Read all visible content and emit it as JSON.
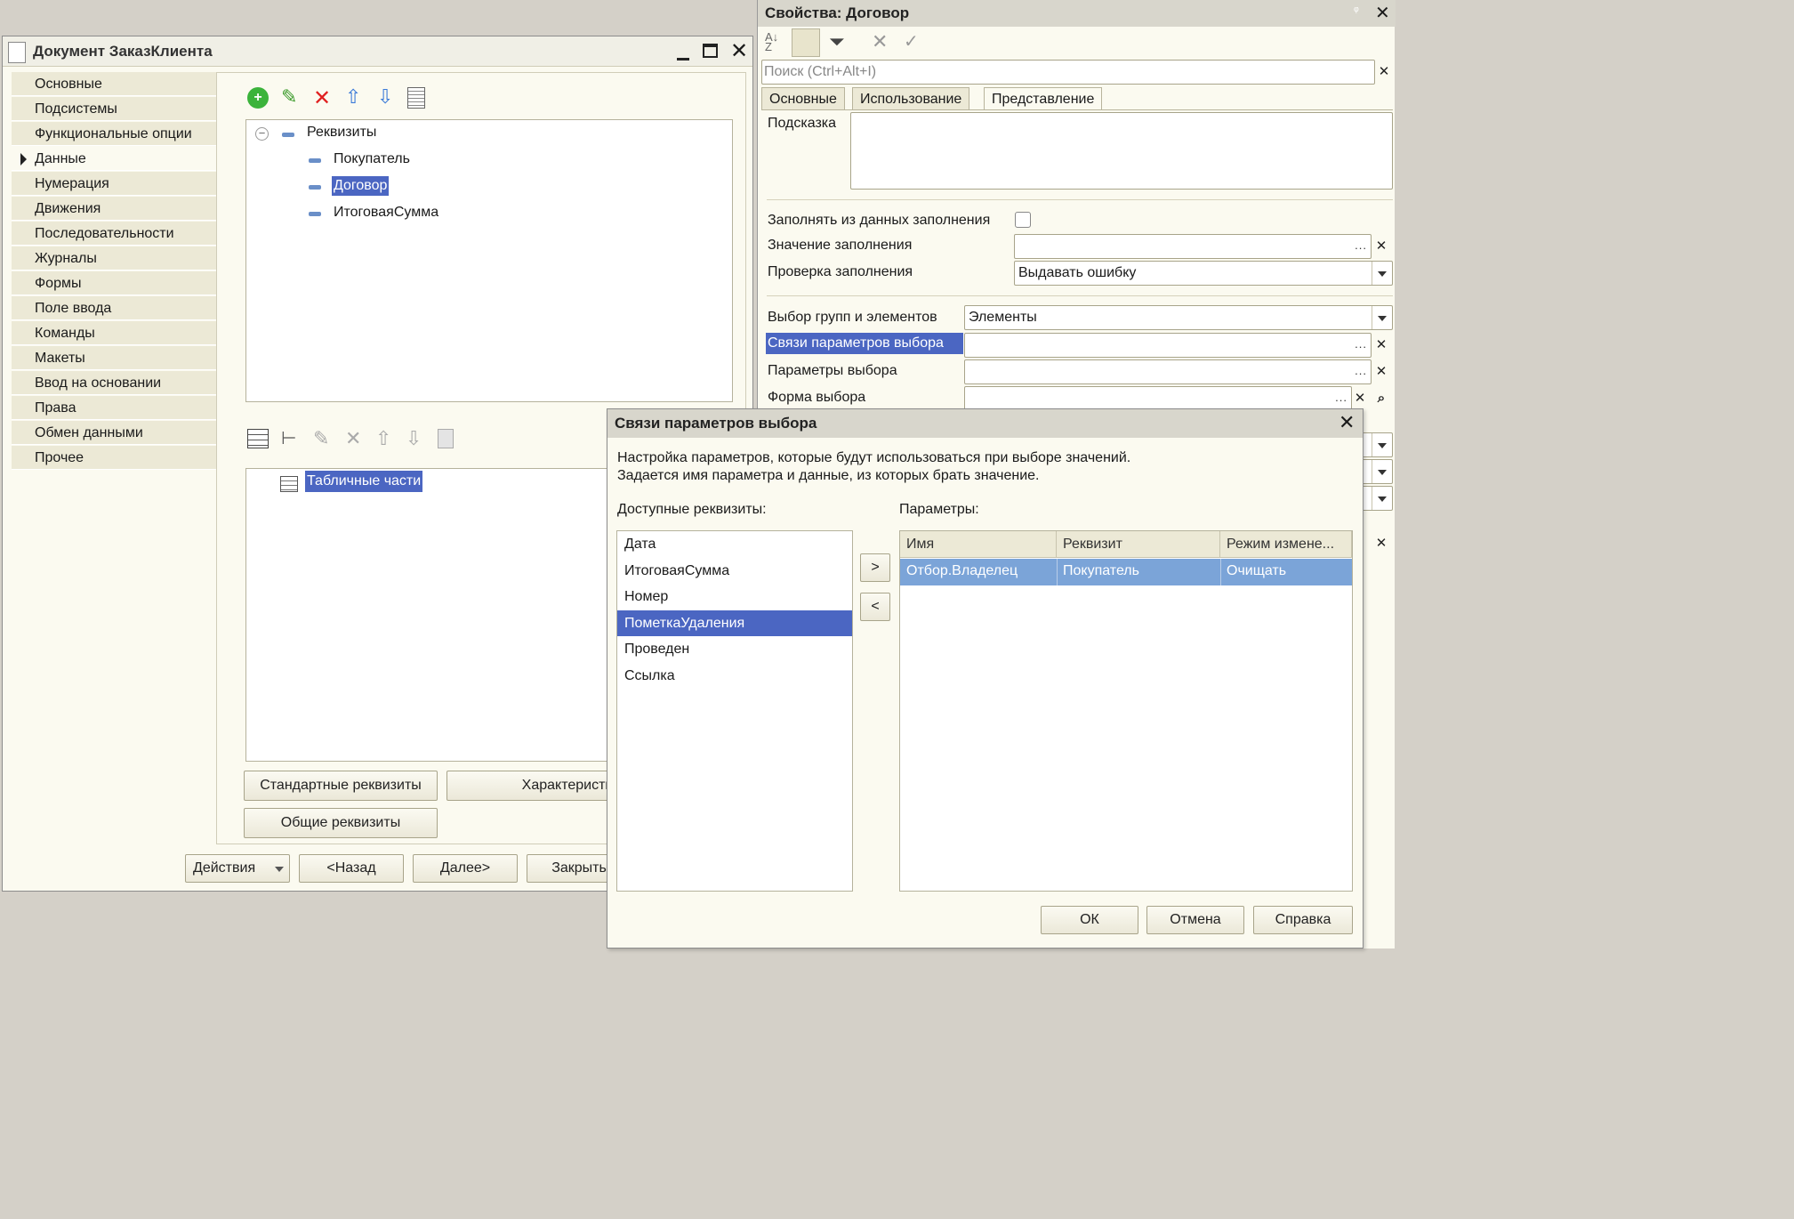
{
  "doc_window": {
    "title": "Документ ЗаказКлиента",
    "nav": [
      "Основные",
      "Подсистемы",
      "Функциональные опции",
      "Данные",
      "Нумерация",
      "Движения",
      "Последовательности",
      "Журналы",
      "Формы",
      "Поле ввода",
      "Команды",
      "Макеты",
      "Ввод на основании",
      "Права",
      "Обмен данными",
      "Прочее"
    ],
    "active_nav": "Данные",
    "tree_root": "Реквизиты",
    "tree_items": [
      "Покупатель",
      "Договор",
      "ИтоговаяСумма"
    ],
    "selected_item": "Договор",
    "tabular_root": "Табличные части",
    "buttons": {
      "standard": "Стандартные реквизиты",
      "characteristics": "Характеристики",
      "common": "Общие реквизиты"
    },
    "footer": {
      "actions": "Действия",
      "back": "<Назад",
      "next": "Далее>",
      "close": "Закрыть"
    }
  },
  "props_panel": {
    "title": "Свойства: Договор",
    "search_placeholder": "Поиск (Ctrl+Alt+I)",
    "tabs": [
      "Основные",
      "Использование",
      "Представление"
    ],
    "active_tab": "Представление",
    "hint_label": "Подсказка",
    "fill_from_data": "Заполнять из данных заполнения",
    "fill_value": "Значение заполнения",
    "fill_check": "Проверка заполнения",
    "fill_check_value": "Выдавать ошибку",
    "select_groups": "Выбор групп и элементов",
    "select_groups_value": "Элементы",
    "choice_links": "Связи параметров выбора",
    "choice_params": "Параметры выбора",
    "choice_form": "Форма выбора"
  },
  "dialog": {
    "title": "Связи параметров выбора",
    "desc1": "Настройка параметров, которые будут использоваться при выборе значений.",
    "desc2": "Задается имя параметра и данные, из которых брать значение.",
    "available_label": "Доступные реквизиты:",
    "params_label": "Параметры:",
    "available": [
      "Дата",
      "ИтоговаяСумма",
      "Номер",
      "ПометкаУдаления",
      "Проведен",
      "Ссылка"
    ],
    "selected_available": "ПометкаУдаления",
    "columns": [
      "Имя",
      "Реквизит",
      "Режим измене..."
    ],
    "rows": [
      {
        "name": "Отбор.Владелец",
        "attr": "Покупатель",
        "mode": "Очищать"
      }
    ],
    "add_btn": ">",
    "remove_btn": "<",
    "ok": "ОК",
    "cancel": "Отмена",
    "help": "Справка"
  }
}
